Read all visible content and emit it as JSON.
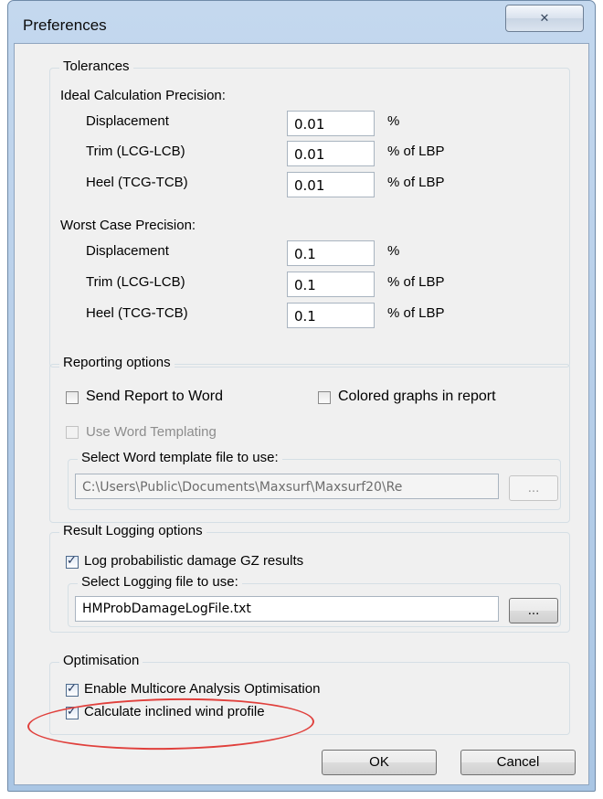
{
  "window": {
    "title": "Preferences",
    "close_glyph": "✕",
    "icon": "close-icon"
  },
  "tolerances": {
    "legend": "Tolerances",
    "ideal": {
      "heading": "Ideal Calculation Precision:",
      "displacement": {
        "label": "Displacement",
        "value": "0.01",
        "unit": "%"
      },
      "trim": {
        "label": "Trim (LCG-LCB)",
        "value": "0.01",
        "unit": "% of LBP"
      },
      "heel": {
        "label": "Heel (TCG-TCB)",
        "value": "0.01",
        "unit": "% of LBP"
      }
    },
    "worst": {
      "heading": "Worst Case Precision:",
      "displacement": {
        "label": "Displacement",
        "value": "0.1",
        "unit": "%"
      },
      "trim": {
        "label": "Trim (LCG-LCB)",
        "value": "0.1",
        "unit": "% of LBP"
      },
      "heel": {
        "label": "Heel (TCG-TCB)",
        "value": "0.1",
        "unit": "% of LBP"
      }
    }
  },
  "reporting": {
    "legend": "Reporting options",
    "send_to_word": {
      "label": "Send Report to Word",
      "checked": false
    },
    "colored_graphs": {
      "label": "Colored graphs in report",
      "checked": false
    },
    "use_templating": {
      "label": "Use Word Templating",
      "checked": false,
      "enabled": false
    },
    "template": {
      "legend": "Select Word template file to use:",
      "path": "C:\\Users\\Public\\Documents\\Maxsurf\\Maxsurf20\\Re",
      "browse_label": "..."
    }
  },
  "logging": {
    "legend": "Result Logging options",
    "log_gz": {
      "label": "Log probabilistic damage GZ results",
      "checked": true
    },
    "file": {
      "legend": "Select Logging file to use:",
      "path": "HMProbDamageLogFile.txt",
      "browse_label": "..."
    }
  },
  "optimisation": {
    "legend": "Optimisation",
    "multicore": {
      "label": "Enable Multicore Analysis Optimisation",
      "checked": true
    },
    "inclined_wind": {
      "label": "Calculate inclined wind profile",
      "checked": true
    },
    "highlight_color": "#e0403c"
  },
  "buttons": {
    "ok": "OK",
    "cancel": "Cancel"
  }
}
